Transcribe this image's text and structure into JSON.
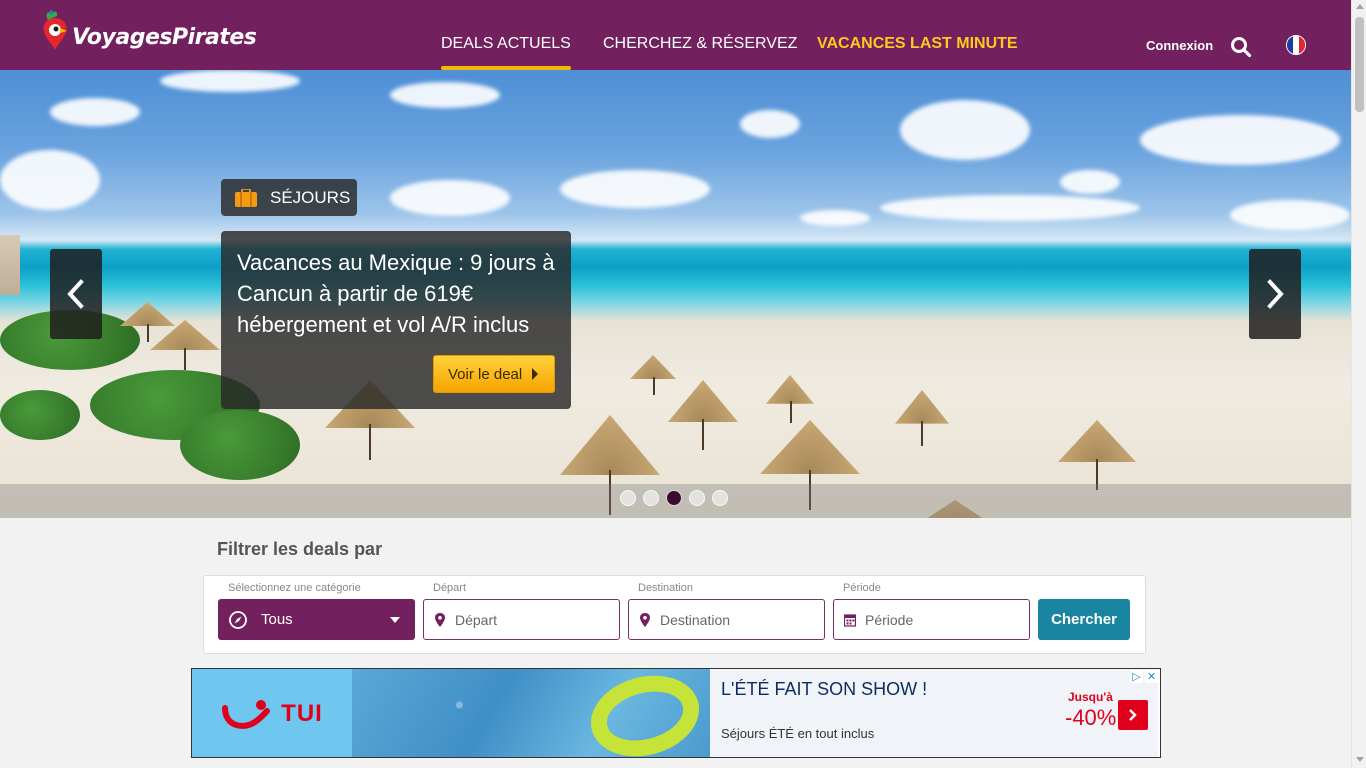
{
  "brand": {
    "name": "VoyagesPirates"
  },
  "nav": {
    "items": [
      {
        "label": "DEALS ACTUELS"
      },
      {
        "label": "CHERCHEZ & RÉSERVEZ"
      },
      {
        "label": "VACANCES LAST MINUTE"
      }
    ],
    "connexion": "Connexion",
    "language": "fr"
  },
  "hero": {
    "badge": "SÉJOURS",
    "title": "Vacances au Mexique : 9 jours à Cancun à partir de 619€ hébergement et vol A/R inclus",
    "cta": "Voir le deal",
    "slides": 5,
    "active_slide": 3
  },
  "filter": {
    "title": "Filtrer les deals par",
    "category_label": "Sélectionnez une catégorie",
    "category_value": "Tous",
    "depart_label": "Départ",
    "depart_placeholder": "Départ",
    "destination_label": "Destination",
    "destination_placeholder": "Destination",
    "periode_label": "Période",
    "periode_placeholder": "Période",
    "search": "Chercher"
  },
  "ad": {
    "brand": "TUI",
    "headline": "L'ÉTÉ FAIT SON SHOW !",
    "subline": "Séjours ÉTÉ en tout inclus",
    "upto": "Jusqu'à",
    "discount": "-40%"
  },
  "colors": {
    "header": "#72205e",
    "accent": "#ffc820",
    "search_button": "#1a85a0",
    "ad_red": "#e0001b"
  }
}
